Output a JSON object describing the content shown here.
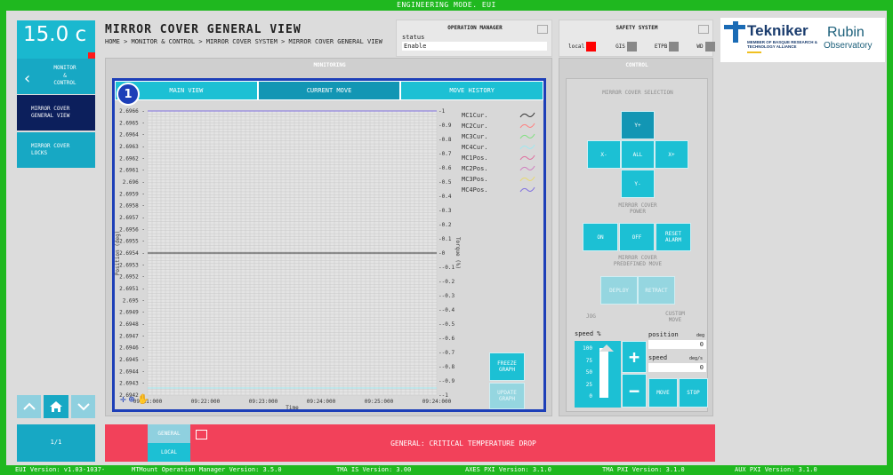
{
  "topbar": {
    "title": "ENGINEERING MODE. EUI"
  },
  "temperature": {
    "value": "15.0 c"
  },
  "header": {
    "title": "MIRROR COVER GENERAL VIEW",
    "breadcrumb": "HOME > MONITOR & CONTROL > MIRROR COVER SYSTEM > MIRROR COVER GENERAL VIEW"
  },
  "operation_manager": {
    "title": "OPERATION MANAGER",
    "status_label": "status",
    "status_value": "Enable"
  },
  "safety_system": {
    "title": "SAFETY SYSTEM",
    "items": [
      {
        "label": "local",
        "color": "#ff0000"
      },
      {
        "label": "GIS",
        "color": "#888888"
      },
      {
        "label": "ETPB",
        "color": "#888888"
      },
      {
        "label": "WD",
        "color": "#888888"
      }
    ]
  },
  "logos": {
    "tekniker": "Tekniker",
    "tekniker_sub": "MEMBER OF BASQUE RESEARCH & TECHNOLOGY ALLIANCE",
    "rubin": "Rubin",
    "rubin_sub": "Observatory"
  },
  "sidebar": {
    "items": [
      {
        "label": "MONITOR & CONTROL"
      },
      {
        "label": "MIRROR COVER GENERAL VIEW"
      },
      {
        "label": "MIRROR COVER LOCKS"
      }
    ],
    "page": "1/1"
  },
  "monitoring": {
    "title": "MONITORING",
    "badge": "1",
    "tabs": [
      "MAIN VIEW",
      "CURRENT MOVE",
      "MOVE HISTORY"
    ],
    "freeze": "FREEZE GRAPH",
    "update": "UPDATE GRAPH"
  },
  "control": {
    "title": "CONTROL",
    "selection_label": "MIRROR COVER SELECTION",
    "selection": {
      "yplus": "Y+",
      "xminus": "X-",
      "all": "ALL",
      "xplus": "X+",
      "yminus": "Y-"
    },
    "power_label": "MIRROR COVER POWER",
    "power": {
      "on": "ON",
      "off": "OFF",
      "reset": "RESET ALARM"
    },
    "predef_label": "MIRROR COVER PREDEFINED MOVE",
    "predef": {
      "deploy": "DEPLOY",
      "retract": "RETRACT"
    },
    "jog": "JOG",
    "custom": "CUSTOM MOVE",
    "speed_pct_label": "speed %",
    "speed_ticks": [
      "100",
      "75",
      "50",
      "25",
      "0"
    ],
    "slider_level_pct": 100,
    "position_label": "position",
    "position_unit": "deg",
    "position_value": "0",
    "speed_label": "speed",
    "speed_unit": "deg/s",
    "speed_value": "0",
    "plus": "+",
    "minus": "−",
    "move": "MOVE",
    "stop": "STOP"
  },
  "alarm": {
    "tab_general": "GENERAL",
    "tab_local": "LOCAL",
    "message": "GENERAL: CRITICAL TEMPERATURE DROP"
  },
  "footer": {
    "items": [
      "EUI Version: v1.03-1037-",
      "MTMount Operation Manager Version: 3.5.0",
      "TMA IS Version: 3.00",
      "AXES PXI Version: 3.1.0",
      "TMA PXI Version: 3.1.0",
      "AUX PXI Version: 3.1.0"
    ]
  },
  "chart_data": {
    "type": "line",
    "xlabel": "Time",
    "ylabel_left": "Position (deg)",
    "ylabel_right": "Torque (%)",
    "x_ticks": [
      "09:21:000",
      "09:22:000",
      "09:23:000",
      "09:24:000",
      "09:25:000",
      "09:24:000"
    ],
    "y_left_ticks": [
      "2.6966",
      "2.6965",
      "2.6964",
      "2.6963",
      "2.6962",
      "2.6961",
      "2.696",
      "2.6959",
      "2.6958",
      "2.6957",
      "2.6956",
      "2.6955",
      "2.6954",
      "2.6953",
      "2.6952",
      "2.6951",
      "2.695",
      "2.6949",
      "2.6948",
      "2.6947",
      "2.6946",
      "2.6945",
      "2.6944",
      "2.6943",
      "2.6942"
    ],
    "y_right_ticks": [
      "1",
      "0.9",
      "0.8",
      "0.7",
      "0.6",
      "0.5",
      "0.4",
      "0.3",
      "0.2",
      "0.1",
      "0",
      "-0.1",
      "-0.2",
      "-0.3",
      "-0.4",
      "-0.5",
      "-0.6",
      "-0.7",
      "-0.8",
      "-0.9",
      "-1"
    ],
    "y_right_range": [
      -1,
      1
    ],
    "grid": true,
    "legend_position": "right",
    "series": [
      {
        "name": "MC1Cur.",
        "color": "#333333",
        "axis": "right",
        "values": [
          0,
          0
        ]
      },
      {
        "name": "MC2Cur.",
        "color": "#ff8080",
        "axis": "right",
        "values": [
          1,
          1
        ]
      },
      {
        "name": "MC3Cur.",
        "color": "#80e080",
        "axis": "right",
        "values": [
          -0.95,
          -0.95
        ]
      },
      {
        "name": "MC4Cur.",
        "color": "#a0e8f0",
        "axis": "right",
        "values": [
          -0.95,
          -0.95
        ]
      },
      {
        "name": "MC1Pos.",
        "color": "#e070a0",
        "axis": "right",
        "values": [
          null,
          null
        ]
      },
      {
        "name": "MC2Pos.",
        "color": "#d080c0",
        "axis": "right",
        "values": [
          null,
          null
        ]
      },
      {
        "name": "MC3Pos.",
        "color": "#e8d870",
        "axis": "right",
        "values": [
          null,
          null
        ]
      },
      {
        "name": "MC4Pos.",
        "color": "#8070e0",
        "axis": "right",
        "values": [
          1,
          1
        ]
      }
    ]
  }
}
